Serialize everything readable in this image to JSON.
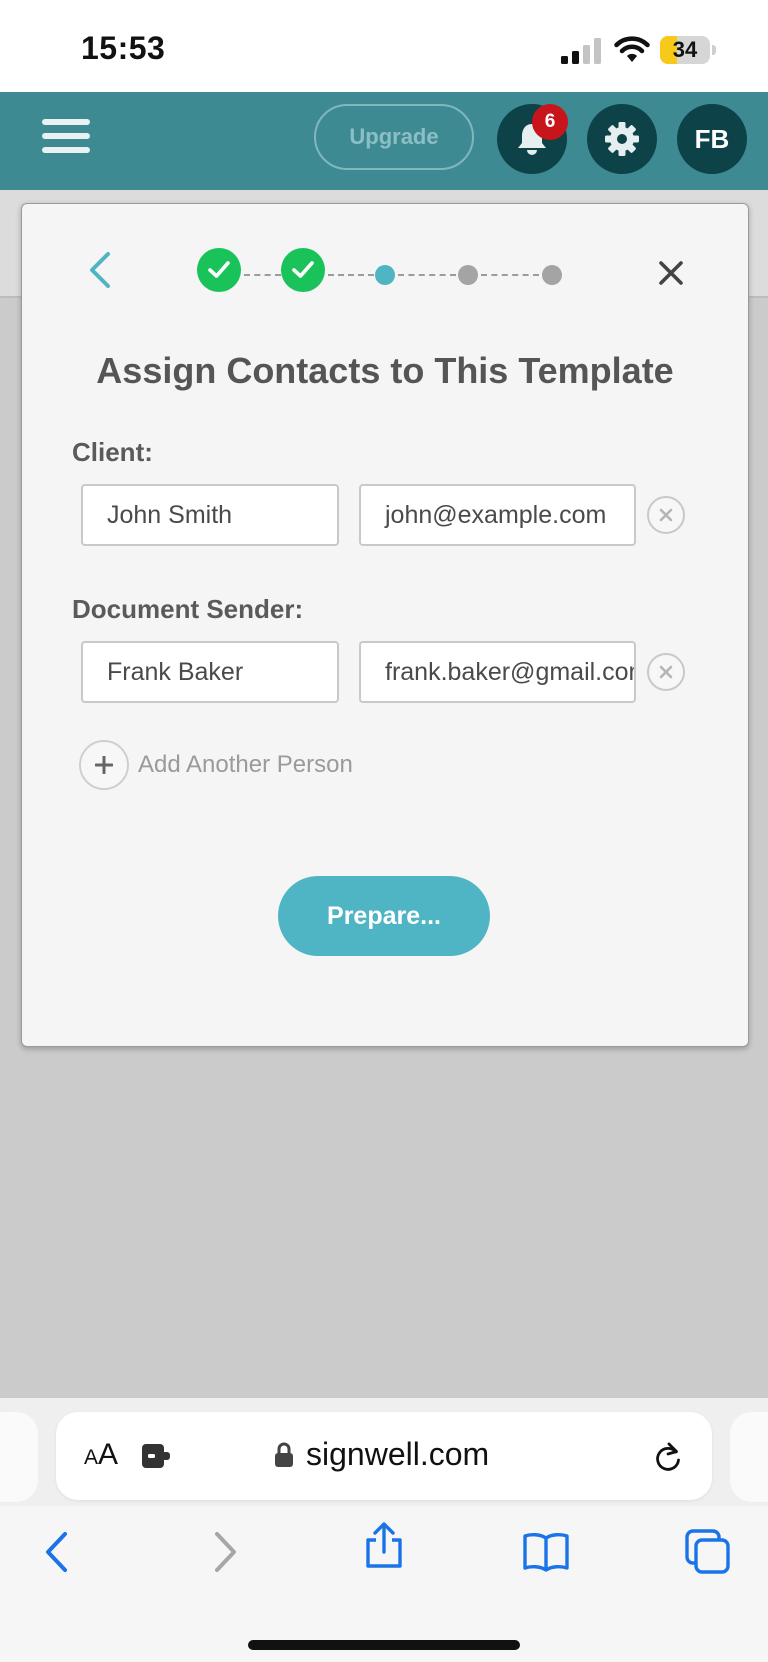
{
  "status_bar": {
    "time": "15:53",
    "battery_percent": "34",
    "battery_level": 0.34,
    "battery_color": "#f6c91b"
  },
  "header": {
    "menu_icon": "hamburger-menu-icon",
    "upgrade_label": "Upgrade",
    "notification_count": "6",
    "notification_icon": "bell-icon",
    "settings_icon": "gear-icon",
    "avatar_initials": "FB",
    "bar_color": "#3e8a93"
  },
  "modal": {
    "title": "Assign Contacts to This Template",
    "steps": [
      {
        "state": "complete"
      },
      {
        "state": "complete"
      },
      {
        "state": "current"
      },
      {
        "state": "upcoming"
      },
      {
        "state": "upcoming"
      }
    ],
    "contacts": [
      {
        "role_label": "Client:",
        "name": "John Smith",
        "email": "john@example.com"
      },
      {
        "role_label": "Document Sender:",
        "name": "Frank Baker",
        "email": "frank.baker@gmail.com"
      }
    ],
    "add_person_label": "Add Another Person",
    "primary_button": "Prepare...",
    "accent_color": "#4fb5c4",
    "complete_color": "#19c35a"
  },
  "browser": {
    "text_size_label_small": "A",
    "text_size_label_large": "A",
    "url": "signwell.com",
    "toolbar_icons": [
      "back-icon",
      "forward-icon",
      "share-icon",
      "bookmarks-icon",
      "tabs-icon"
    ]
  }
}
